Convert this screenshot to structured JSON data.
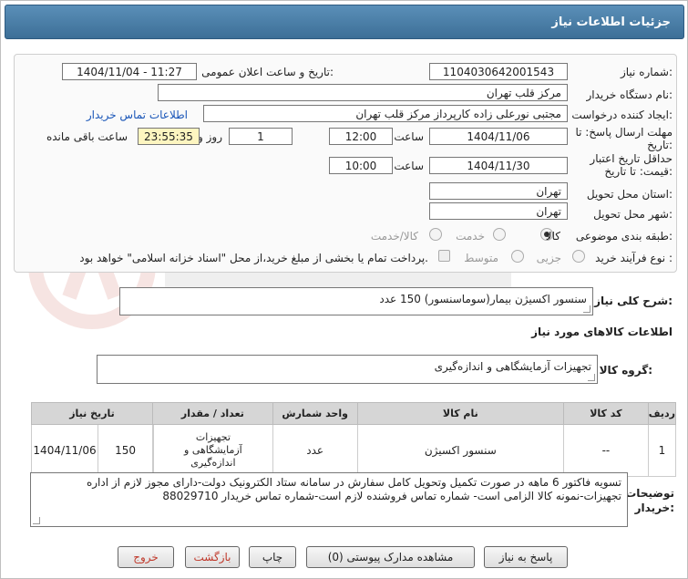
{
  "header": {
    "title": "جزئیات اطلاعات نیاز"
  },
  "form": {
    "need_number_label": "شماره نیاز:",
    "need_number": "1104030642001543",
    "announce_label": "تاریخ و ساعت اعلان عمومی:",
    "announce_value": "1404/11/04 - 11:27",
    "buyer_org_label": "نام دستگاه خریدار:",
    "buyer_org": "مرکز قلب تهران",
    "creator_label": "ایجاد کننده درخواست:",
    "creator": "مجتبی نورعلی زاده کارپرداز مرکز قلب تهران",
    "contact_link": "اطلاعات تماس خریدار",
    "reply_deadline_label_1": "مهلت ارسال پاسخ: تا",
    "reply_deadline_label_2": "تاریخ:",
    "reply_date": "1404/11/06",
    "time_label": "ساعت",
    "reply_time": "12:00",
    "days_value": "1",
    "days_label": "روز و",
    "remaining_time": "23:55:35",
    "remaining_label": "ساعت باقی مانده",
    "validity_label_1": "حداقل تاریخ اعتبار",
    "validity_label_2": "قیمت: تا تاریخ:",
    "validity_date": "1404/11/30",
    "validity_time": "10:00",
    "province_label": "استان محل تحویل:",
    "province": "تهران",
    "city_label": "شهر محل تحویل:",
    "city": "تهران",
    "category_label": "طبقه بندی موضوعی:",
    "category_options": [
      "کالا",
      "خدمت",
      "کالا/خدمت"
    ],
    "process_label": "نوع فرآیند خرید :",
    "process_options": [
      "جزیی",
      "متوسط"
    ],
    "payment_note": "پرداخت تمام یا بخشی از مبلغ خرید،از محل \"اسناد خزانه اسلامی\" خواهد بود."
  },
  "summary": {
    "label": "شرح کلی نیاز:",
    "value": "سنسور اکسیژن بیمار(سوماسنسور) 150 عدد"
  },
  "goods": {
    "section_title": "اطلاعات کالاهای مورد نیاز",
    "group_label": "گروه کالا:",
    "group_value": "تجهیزات آزمایشگاهی و اندازه‌گیری"
  },
  "table": {
    "headers": [
      "ردیف",
      "کد کالا",
      "نام کالا",
      "واحد شمارش",
      "تعداد / مقدار",
      "تاریخ نیاز"
    ],
    "rows": [
      {
        "row": "1",
        "code": "--",
        "name": "سنسور اکسیژن",
        "unit": "عدد",
        "quantity": "150",
        "need_date": "1404/11/06",
        "group_line1": "تجهیزات",
        "group_line2": "آزمایشگاهی و",
        "group_line3": "اندازه‌گیری"
      }
    ]
  },
  "buyer_notes": {
    "label_1": "توضیحات",
    "label_2": "خریدار:",
    "line1": "تسویه فاکتور 6 ماهه در صورت تکمیل وتحویل کامل سفارش در سامانه  ستاد الکترونیک دولت-دارای مجوز لازم از اداره",
    "line2": "تجهیزات-نمونه کالا الزامی است- شماره تماس فروشنده لازم است-شماره تماس خریدار 88029710"
  },
  "buttons": {
    "reply": "پاسخ به نیاز",
    "attachments": "مشاهده مدارک پیوستی (0)",
    "print": "چاپ",
    "back": "بازگشت",
    "exit": "خروج"
  },
  "colors": {
    "header_bg": "#4a7fa8",
    "link": "#1a56b8",
    "remaining_bg": "#fdf5c0",
    "exit_text": "#c0392b"
  }
}
